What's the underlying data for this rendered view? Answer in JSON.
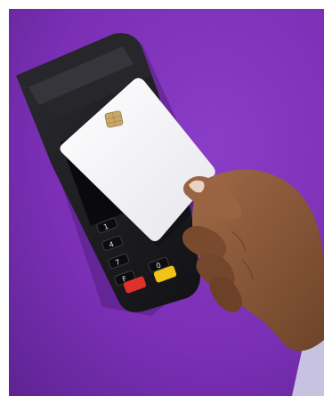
{
  "photo": {
    "subject": "hand-tapping-card-on-payment-terminal",
    "background_color": "#7a2fb5",
    "terminal_color": "#1c1c20",
    "card_color": "#f1f1f4",
    "chip_color": "#c9a86a",
    "skin_color": "#8a5a3c",
    "sleeve_color": "#c7c2e0",
    "red_key_color": "#e0302a",
    "yellow_key_color": "#f2c21a"
  },
  "keypad": {
    "keys": [
      "1",
      "4",
      "7",
      "F",
      "0"
    ]
  }
}
